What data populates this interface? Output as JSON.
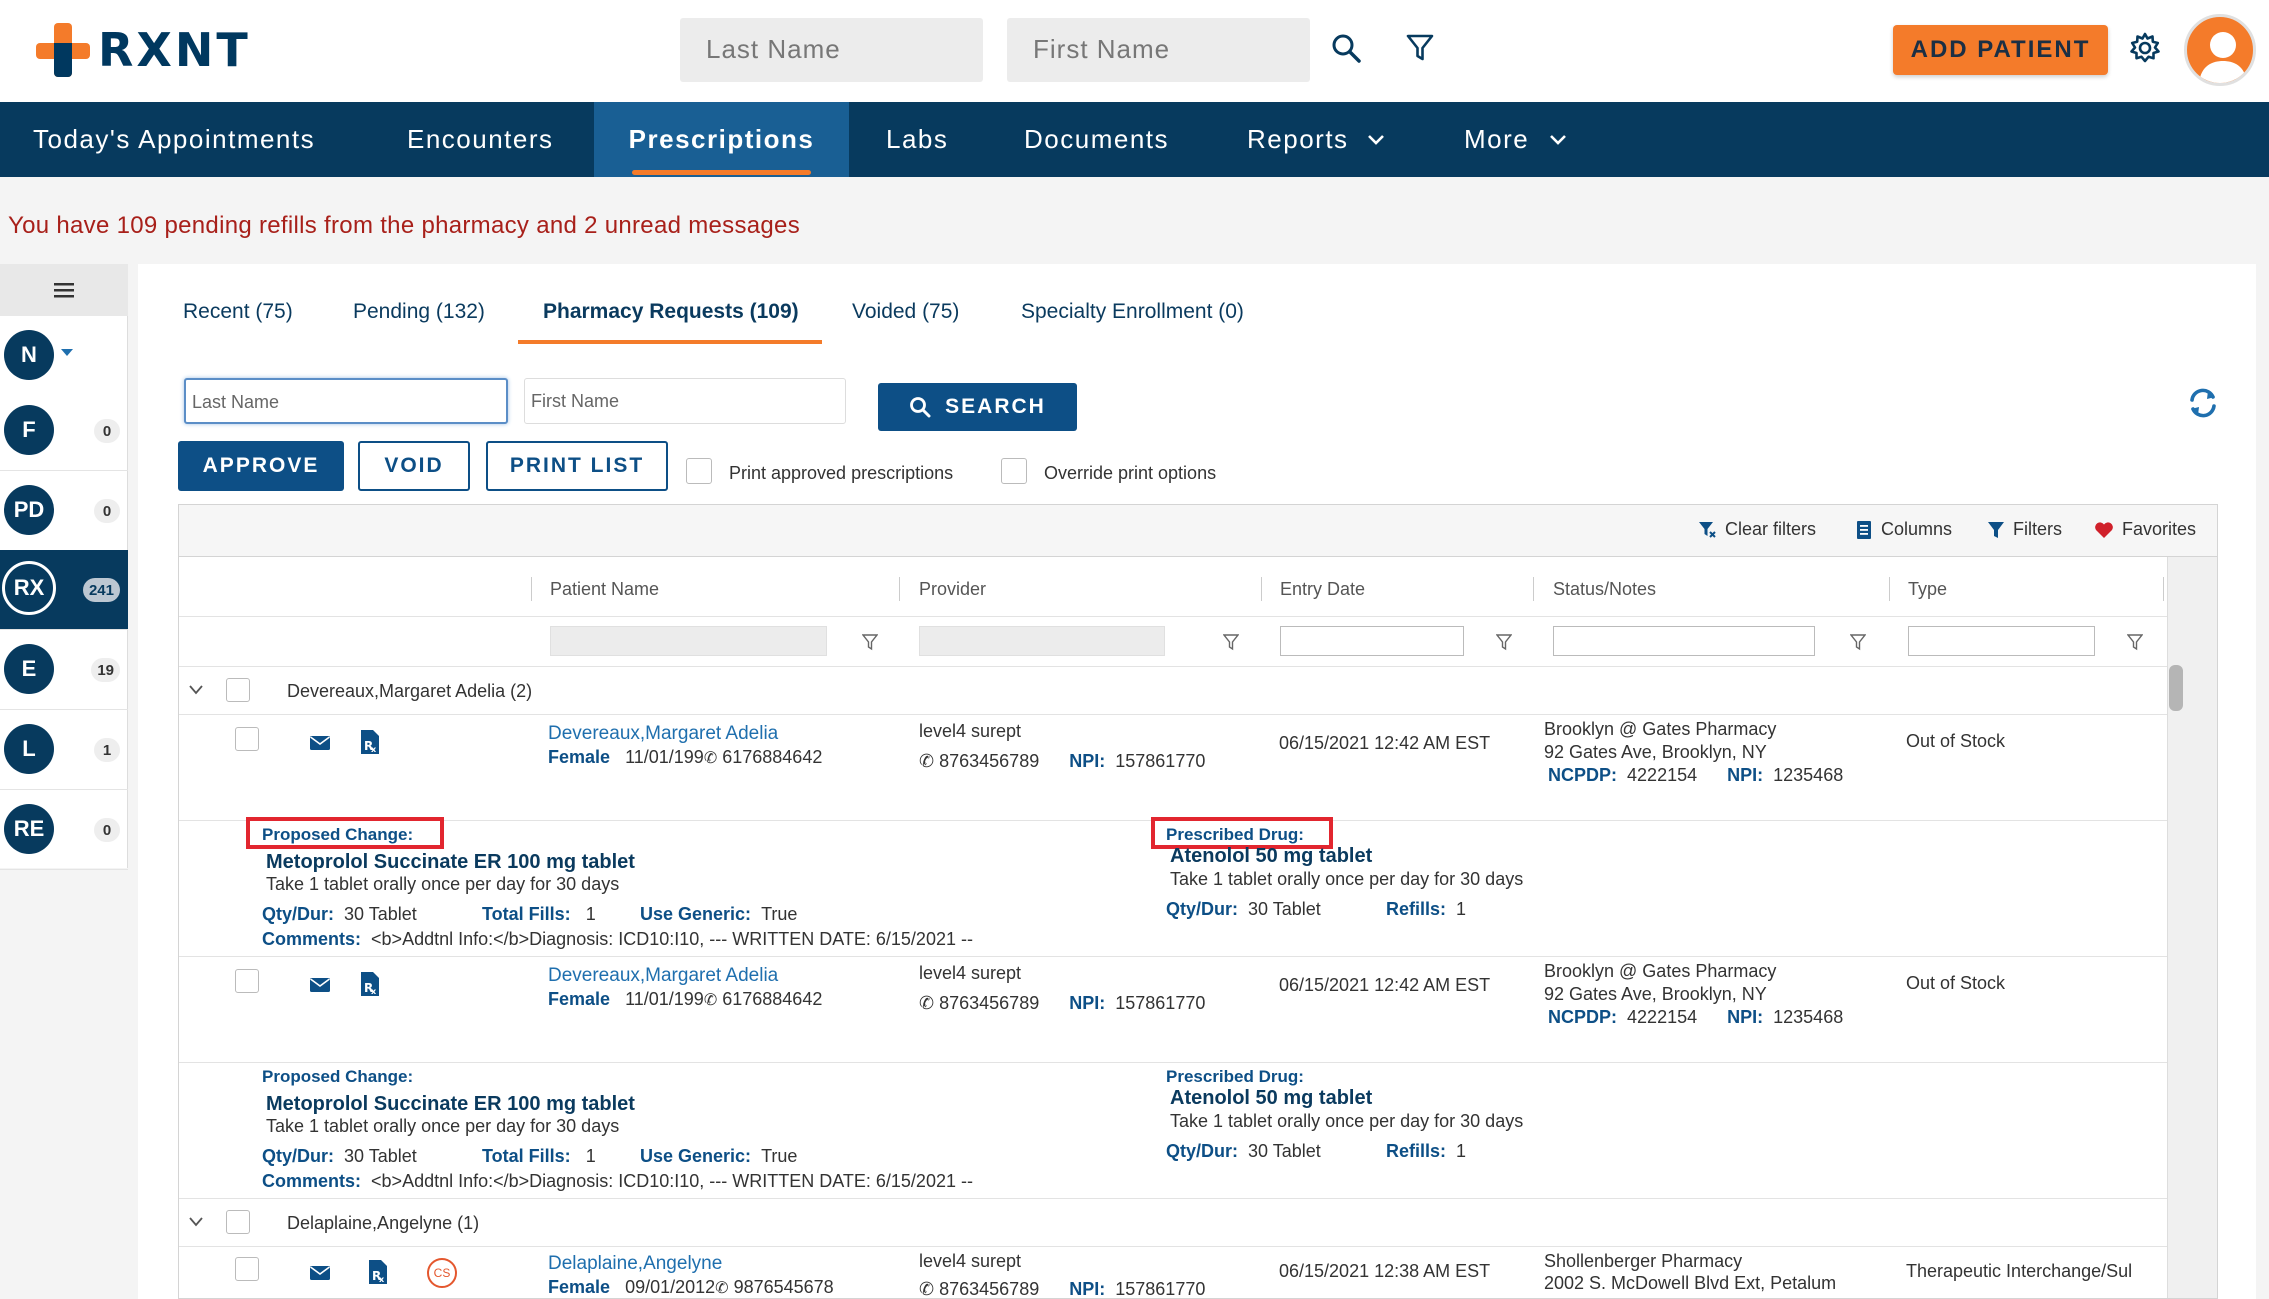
{
  "header": {
    "brand": "RXNT",
    "last_name_placeholder": "Last Name",
    "first_name_placeholder": "First Name",
    "add_patient_label": "ADD PATIENT"
  },
  "nav": {
    "items": [
      {
        "label": "Today's Appointments"
      },
      {
        "label": "Encounters"
      },
      {
        "label": "Prescriptions"
      },
      {
        "label": "Labs"
      },
      {
        "label": "Documents"
      },
      {
        "label": "Reports"
      },
      {
        "label": "More"
      }
    ],
    "active": "Prescriptions"
  },
  "alert": {
    "text": "You have 109 pending refills from the pharmacy  and 2 unread messages"
  },
  "rail": {
    "items": [
      {
        "letter": "N",
        "count": ""
      },
      {
        "letter": "F",
        "count": "0"
      },
      {
        "letter": "PD",
        "count": "0"
      },
      {
        "letter": "RX",
        "count": "241"
      },
      {
        "letter": "E",
        "count": "19"
      },
      {
        "letter": "L",
        "count": "1"
      },
      {
        "letter": "RE",
        "count": "0"
      }
    ]
  },
  "tabs": [
    {
      "label": "Recent (75)"
    },
    {
      "label": "Pending (132)"
    },
    {
      "label": "Pharmacy Requests (109)"
    },
    {
      "label": "Voided (75)"
    },
    {
      "label": "Specialty Enrollment (0)"
    }
  ],
  "search": {
    "last_name_placeholder": "Last Name",
    "first_name_placeholder": "First Name",
    "button_label": "SEARCH"
  },
  "actions": {
    "approve": "APPROVE",
    "void": "VOID",
    "print_list": "PRINT LIST",
    "print_approved": "Print approved prescriptions",
    "override_print": "Override print options"
  },
  "toolbar": {
    "clear_filters": "Clear filters",
    "columns": "Columns",
    "filters": "Filters",
    "favorites": "Favorites"
  },
  "columns": {
    "patient_name": "Patient Name",
    "provider": "Provider",
    "entry_date": "Entry Date",
    "status_notes": "Status/Notes",
    "type": "Type"
  },
  "groups": [
    {
      "label": "Devereaux,Margaret Adelia (2)"
    },
    {
      "label": "Delaplaine,Angelyne (1)"
    }
  ],
  "labels": {
    "proposed_change": "Proposed Change:",
    "prescribed_drug": "Prescribed Drug:",
    "qty_dur": "Qty/Dur:",
    "total_fills": "Total Fills:",
    "use_generic": "Use Generic:",
    "comments": "Comments:",
    "refills": "Refills:",
    "npi": "NPI:",
    "ncpdp": "NCPDP:"
  },
  "rows": [
    {
      "patient": "Devereaux,Margaret Adelia",
      "gender": "Female",
      "dob": "11/01/199",
      "phone": "6176884642",
      "provider": "level4 surept",
      "provider_phone": "8763456789",
      "provider_npi": "157861770",
      "entry_date": "06/15/2021 12:42 AM EST",
      "pharmacy": "Brooklyn @ Gates Pharmacy",
      "address": "92 Gates Ave, Brooklyn, NY",
      "ncpdp": "4222154",
      "pharmacy_npi": "1235468",
      "type": "Out of Stock",
      "proposed_drug": "Metoprolol Succinate ER 100 mg tablet",
      "proposed_sig": "Take 1 tablet orally once per day for 30 days",
      "proposed_qty": "30 Tablet",
      "total_fills": "1",
      "use_generic": "True",
      "comments": "<b>Addtnl Info:</b>Diagnosis: ICD10:I10, --- WRITTEN DATE: 6/15/2021 --",
      "prescribed_drug": "Atenolol 50 mg tablet",
      "prescribed_sig": "Take 1 tablet orally once per day for 30 days",
      "prescribed_qty": "30 Tablet",
      "refills": "1"
    },
    {
      "patient": "Devereaux,Margaret Adelia",
      "gender": "Female",
      "dob": "11/01/199",
      "phone": "6176884642",
      "provider": "level4 surept",
      "provider_phone": "8763456789",
      "provider_npi": "157861770",
      "entry_date": "06/15/2021 12:42 AM EST",
      "pharmacy": "Brooklyn @ Gates Pharmacy",
      "address": "92 Gates Ave, Brooklyn, NY",
      "ncpdp": "4222154",
      "pharmacy_npi": "1235468",
      "type": "Out of Stock",
      "proposed_drug": "Metoprolol Succinate ER 100 mg tablet",
      "proposed_sig": "Take 1 tablet orally once per day for 30 days",
      "proposed_qty": "30 Tablet",
      "total_fills": "1",
      "use_generic": "True",
      "comments": "<b>Addtnl Info:</b>Diagnosis: ICD10:I10, --- WRITTEN DATE: 6/15/2021 --",
      "prescribed_drug": "Atenolol 50 mg tablet",
      "prescribed_sig": "Take 1 tablet orally once per day for 30 days",
      "prescribed_qty": "30 Tablet",
      "refills": "1"
    },
    {
      "patient": "Delaplaine,Angelyne",
      "gender": "Female",
      "dob": "09/01/2012",
      "phone": "9876545678",
      "provider": "level4 surept",
      "provider_phone": "8763456789",
      "provider_npi": "157861770",
      "entry_date": "06/15/2021 12:38 AM EST",
      "pharmacy": "Shollenberger Pharmacy",
      "address": "2002 S. McDowell Blvd Ext, Petalum",
      "type": "Therapeutic Interchange/Sul",
      "cs_badge": "CS"
    }
  ]
}
